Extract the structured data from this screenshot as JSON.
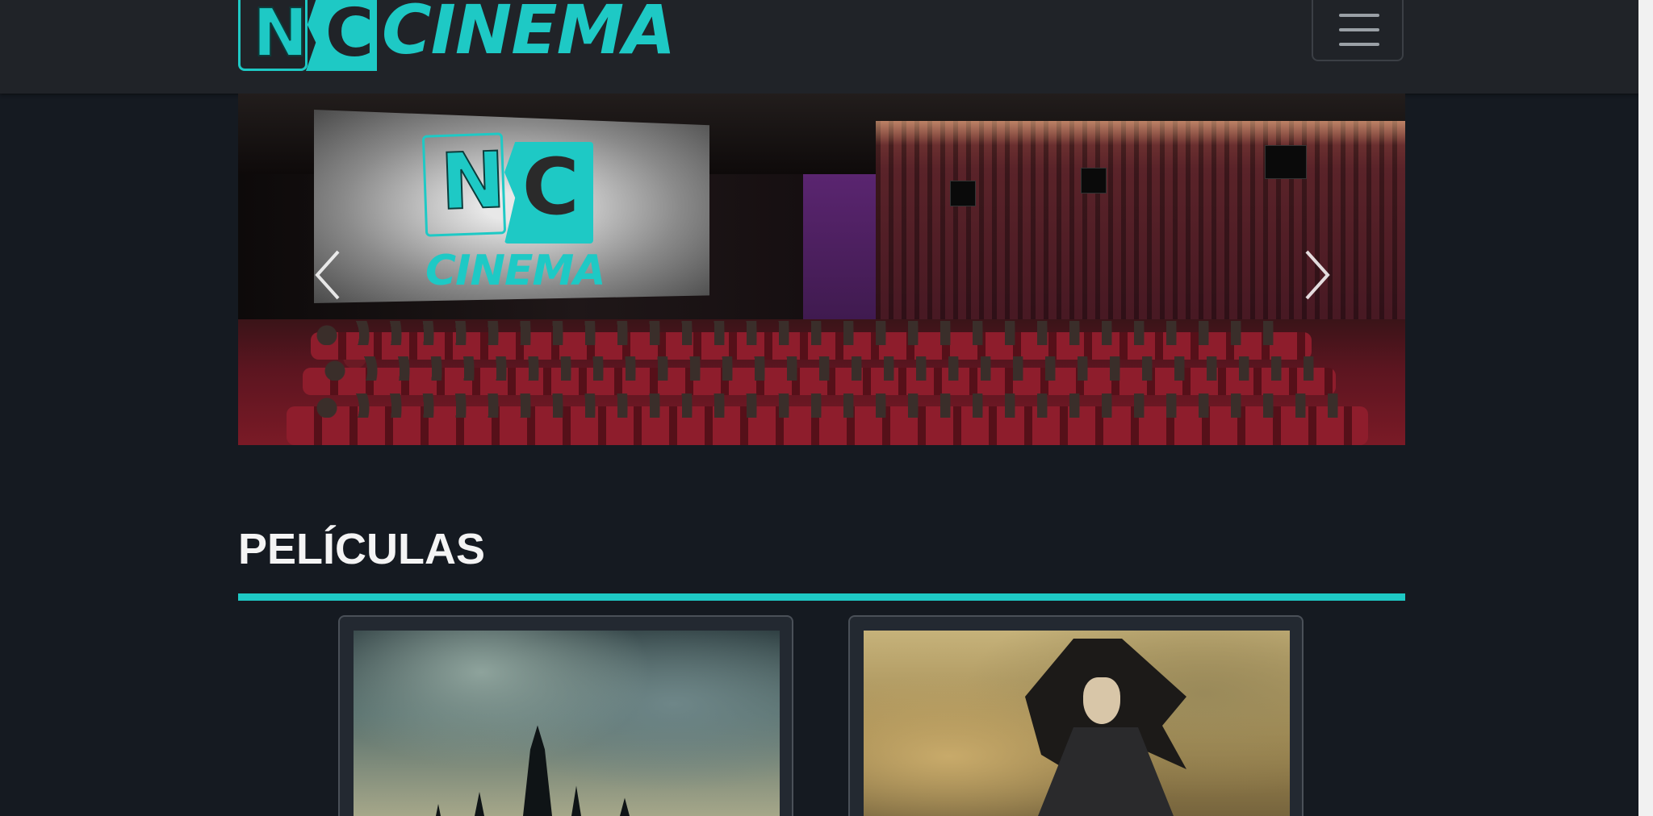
{
  "navbar": {
    "brand_letter_n": "N",
    "brand_letter_c": "C",
    "brand_word": "CINEMA",
    "toggler_icon": "hamburger-menu-icon"
  },
  "carousel": {
    "screen_letter_n": "N",
    "screen_letter_c": "C",
    "screen_word": "CINEMA",
    "prev_icon": "chevron-left-icon",
    "next_icon": "chevron-right-icon"
  },
  "movies_section": {
    "title": "PELÍCULAS"
  },
  "theme": {
    "accent": "#1ec9c5",
    "background": "#151a21",
    "navbar_bg": "#202328",
    "card_bg": "#232931"
  }
}
